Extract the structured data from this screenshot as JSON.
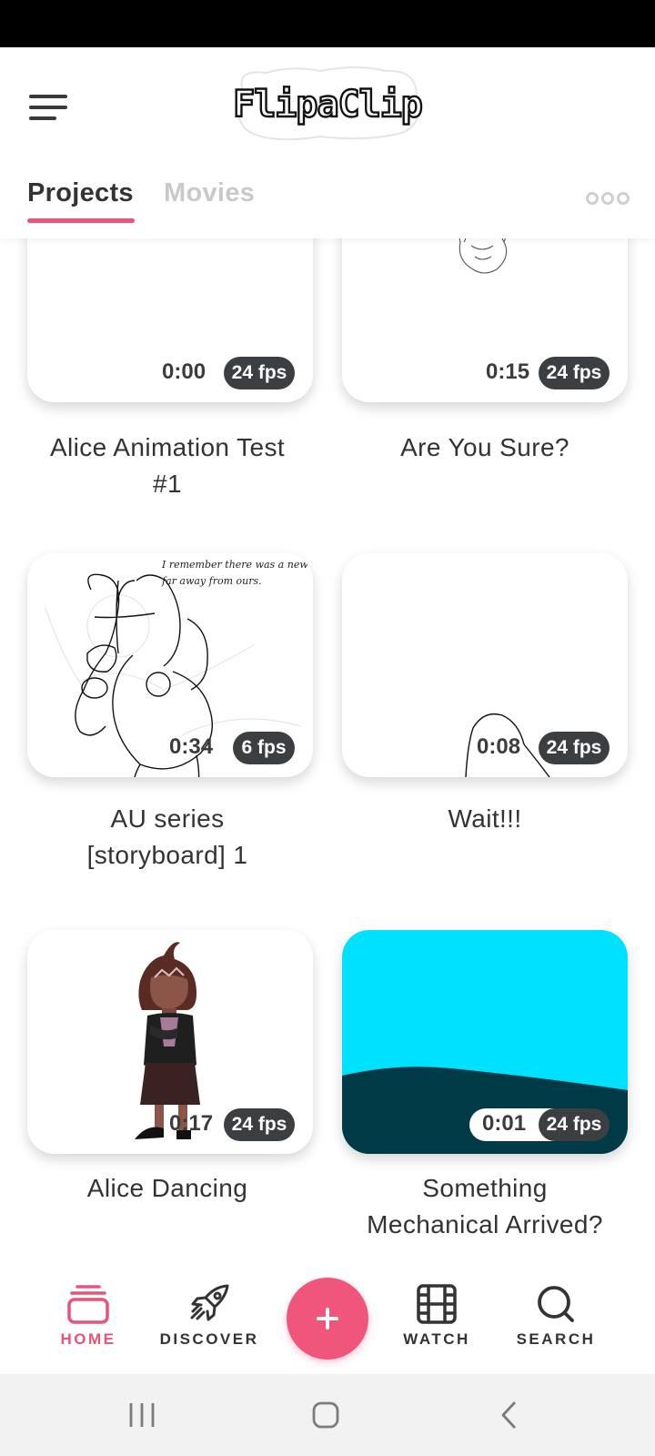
{
  "app": {
    "logo_text": "FlipaClip"
  },
  "tabs": [
    {
      "label": "Projects",
      "active": true
    },
    {
      "label": "Movies",
      "active": false
    }
  ],
  "projects": [
    {
      "title_lines": [
        "Alice Animation Test",
        "#1"
      ],
      "duration": "0:00",
      "fps": "24 fps"
    },
    {
      "title_lines": [
        "Are You Sure?"
      ],
      "duration": "0:15",
      "fps": "24 fps"
    },
    {
      "title_lines": [
        "AU series",
        "[storyboard] 1"
      ],
      "duration": "0:34",
      "fps": "6 fps",
      "thumbnail_text": [
        "I remember there was a new wu..",
        "far away from ours."
      ]
    },
    {
      "title_lines": [
        "Wait!!!"
      ],
      "duration": "0:08",
      "fps": "24 fps"
    },
    {
      "title_lines": [
        "Alice Dancing"
      ],
      "duration": "0:17",
      "fps": "24 fps"
    },
    {
      "title_lines": [
        "Something",
        "Mechanical Arrived?"
      ],
      "duration": "0:01",
      "fps": "24 fps"
    }
  ],
  "bottom_nav": {
    "home": "HOME",
    "discover": "DISCOVER",
    "watch": "WATCH",
    "search": "SEARCH"
  },
  "colors": {
    "accent": "#e8537b",
    "fab": "#f0557c",
    "badge": "#3b3f42",
    "sky": "#00e1fd",
    "ground": "#003a47"
  },
  "icons": {
    "menu": "hamburger-icon",
    "more": "more-options-icon",
    "home": "layers-icon",
    "discover": "rocket-icon",
    "create": "plus-icon",
    "watch": "film-icon",
    "search": "search-icon"
  }
}
